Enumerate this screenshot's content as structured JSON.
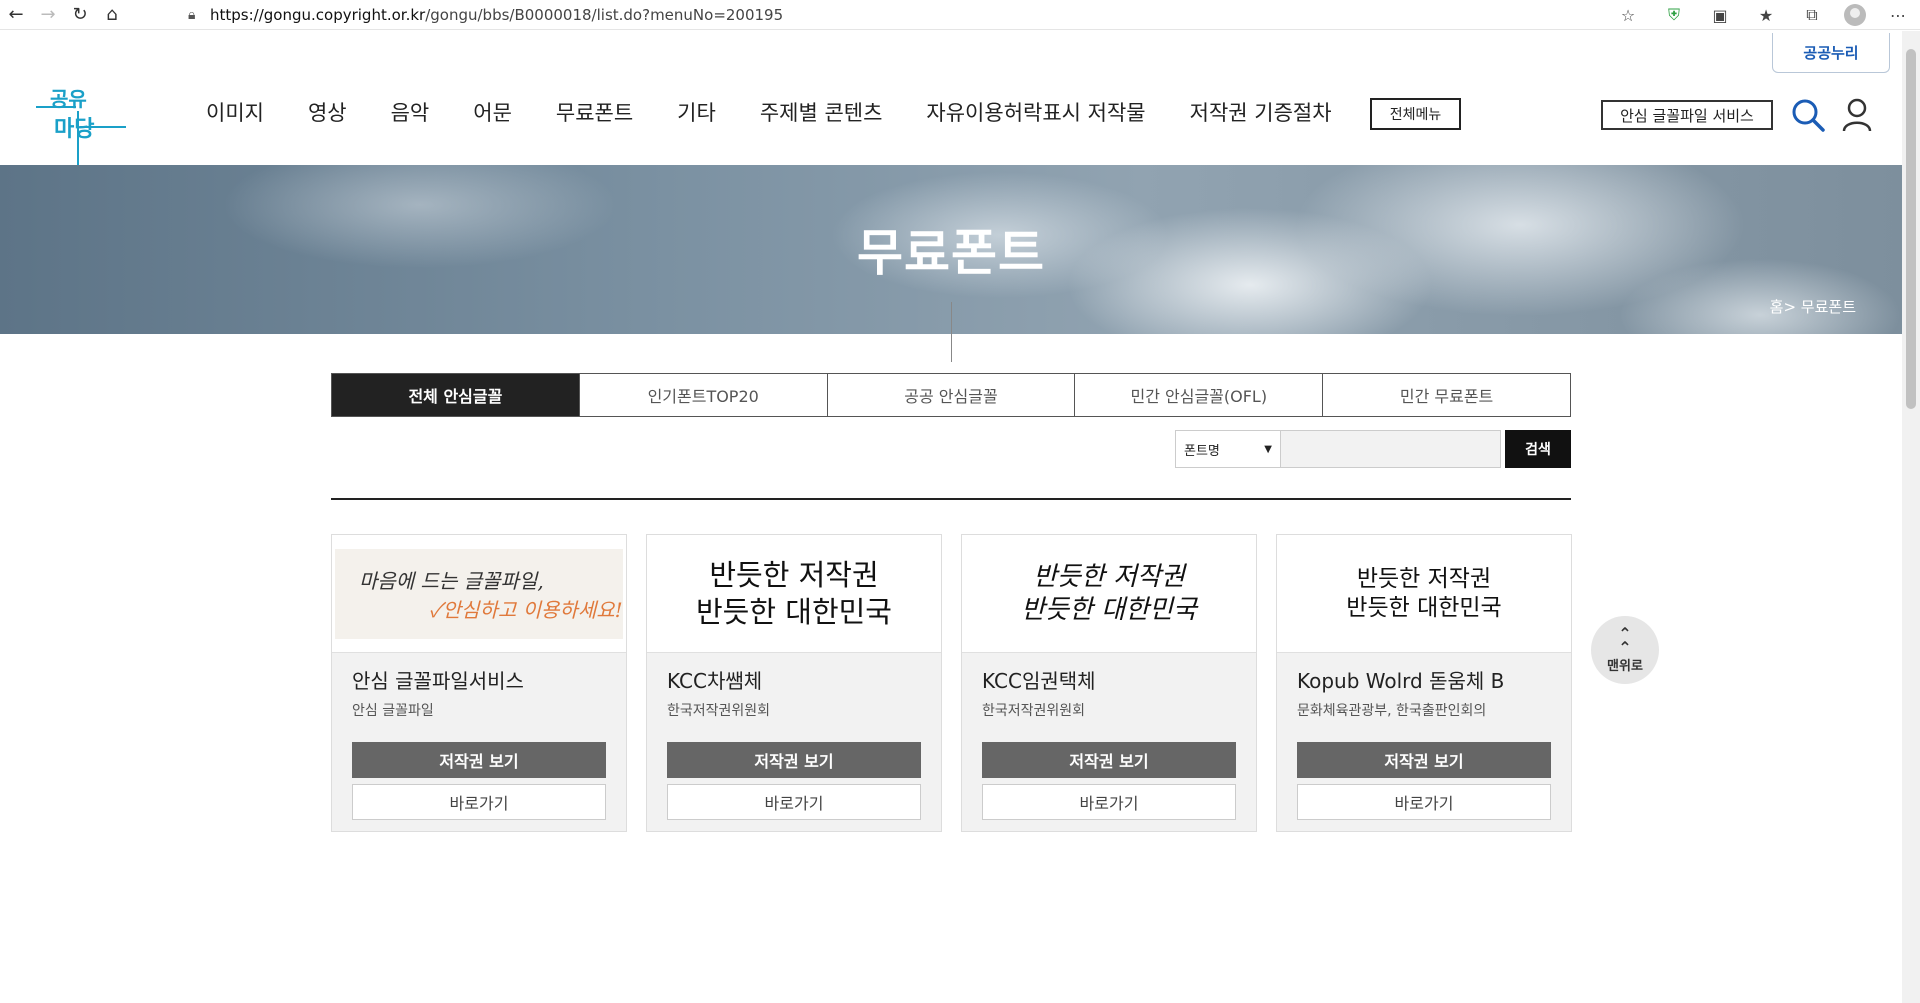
{
  "browser": {
    "url_host": "https://gongu.copyright.or.kr",
    "url_path": "/gongu/bbs/B0000018/list.do?menuNo=200195"
  },
  "header": {
    "gong_nuri": "공공누리",
    "logo_text_top": "공유",
    "logo_text_bottom": "마당",
    "nav": [
      "이미지",
      "영상",
      "음악",
      "어문",
      "무료폰트",
      "기타",
      "주제별 콘텐츠",
      "자유이용허락표시 저작물",
      "저작권 기증절차"
    ],
    "all_menu": "전체메뉴",
    "safe_font_service": "안심 글꼴파일 서비스"
  },
  "banner": {
    "title": "무료폰트",
    "breadcrumb": "홈> 무료폰트"
  },
  "tabs": [
    "전체 안심글꼴",
    "인기폰트TOP20",
    "공공 안심글꼴",
    "민간 안심글꼴(OFL)",
    "민간 무료폰트"
  ],
  "search": {
    "select_value": "폰트명",
    "input_value": "",
    "button": "검색"
  },
  "cards": [
    {
      "thumb_line1": "마음에 드는 글꼴파일,",
      "thumb_line2": "✓안심하고 이용하세요!",
      "title": "안심 글꼴파일서비스",
      "sub": "안심 글꼴파일",
      "btn_copy": "저작권 보기",
      "btn_go": "바로가기"
    },
    {
      "thumb_line1": "반듯한 저작권",
      "thumb_line2": "반듯한 대한민국",
      "title": "KCC차쌤체",
      "sub": "한국저작권위원회",
      "btn_copy": "저작권 보기",
      "btn_go": "바로가기"
    },
    {
      "thumb_line1": "반듯한 저작권",
      "thumb_line2": "반듯한 대한민국",
      "title": "KCC임권택체",
      "sub": "한국저작권위원회",
      "btn_copy": "저작권 보기",
      "btn_go": "바로가기"
    },
    {
      "thumb_line1": "반듯한 저작권",
      "thumb_line2": "반듯한 대한민국",
      "title": "Kopub Wolrd 돋움체 B",
      "sub": "문화체육관광부, 한국출판인회의",
      "btn_copy": "저작권 보기",
      "btn_go": "바로가기"
    }
  ],
  "top_button": "맨위로",
  "colors": {
    "accent_blue": "#1b5cb5",
    "logo_teal": "#1aa0c8",
    "tab_active": "#222222",
    "button_gray": "#666666",
    "thumb_orange": "#e0793b"
  }
}
